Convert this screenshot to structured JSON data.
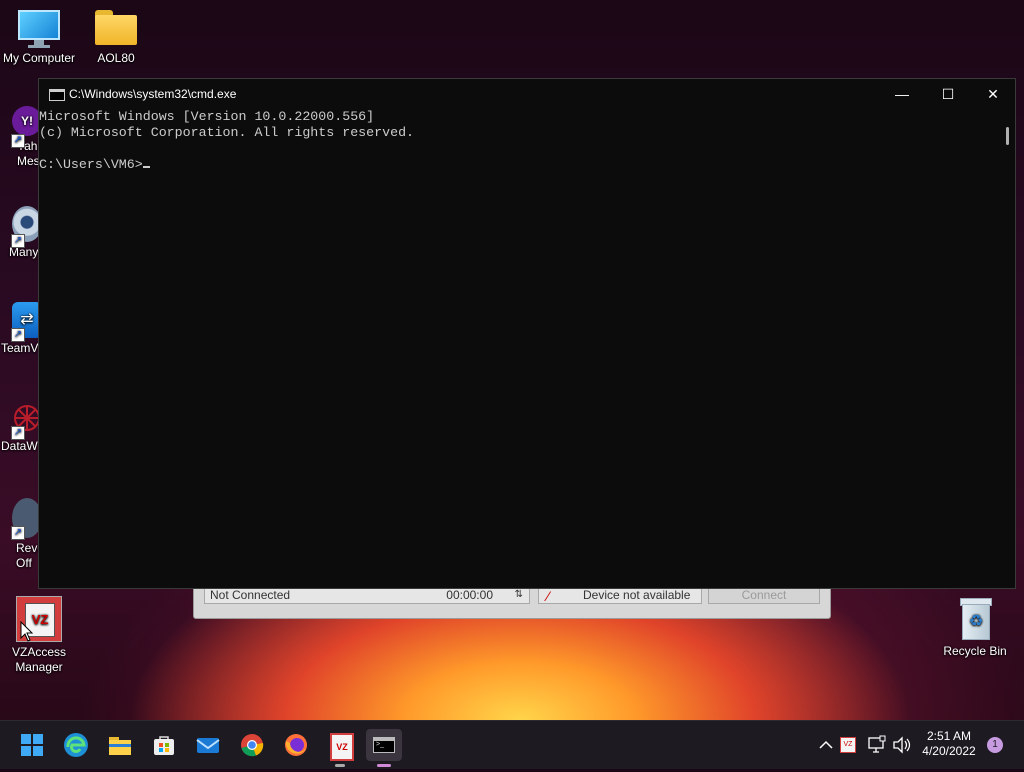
{
  "desktop": {
    "icons": [
      {
        "label": "My Computer"
      },
      {
        "label": "AOL80"
      },
      {
        "label": "Yah Messe"
      },
      {
        "label": "Many"
      },
      {
        "label": "TeamV"
      },
      {
        "label": "DataW"
      },
      {
        "label": "Revo Off"
      },
      {
        "label": "VZAccess Manager"
      },
      {
        "label": "Recycle Bin"
      }
    ]
  },
  "vz_window": {
    "status": "Not Connected",
    "timer": "00:00:00",
    "device": "Device not available",
    "connect_label": "Connect"
  },
  "cmd": {
    "title": "C:\\Windows\\system32\\cmd.exe",
    "minimize": "—",
    "maximize": "☐",
    "close": "✕",
    "lines": [
      "Microsoft Windows [Version 10.0.22000.556]",
      "(c) Microsoft Corporation. All rights reserved.",
      ""
    ],
    "prompt": "C:\\Users\\VM6>"
  },
  "taskbar": {
    "time": "2:51 AM",
    "date": "4/20/2022",
    "notification_count": "1",
    "apps": [
      "start",
      "edge",
      "file-explorer",
      "store",
      "mail",
      "chrome",
      "firefox",
      "vzaccess",
      "cmd"
    ]
  }
}
